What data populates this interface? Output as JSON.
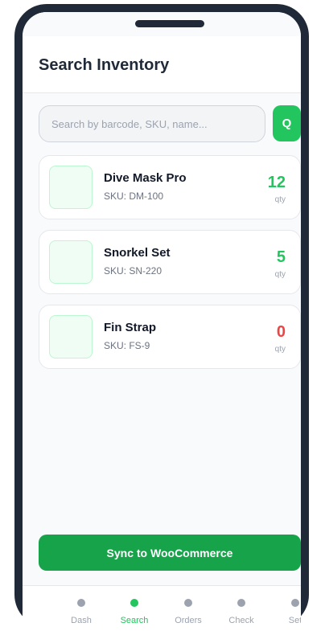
{
  "header": {
    "title": "Search Inventory"
  },
  "search": {
    "placeholder": "Search by barcode, SKU, name...",
    "value": "",
    "button_label": "Q"
  },
  "items": [
    {
      "name": "Dive Mask Pro",
      "sku": "SKU: DM-100",
      "qty": "12",
      "qty_label": "qty",
      "qty_color": "#22c55e"
    },
    {
      "name": "Snorkel Set",
      "sku": "SKU: SN-220",
      "qty": "5",
      "qty_label": "qty",
      "qty_color": "#22c55e"
    },
    {
      "name": "Fin Strap",
      "sku": "SKU: FS-9",
      "qty": "0",
      "qty_label": "qty",
      "qty_color": "#ef4444"
    }
  ],
  "sync": {
    "label": "Sync to WooCommerce"
  },
  "nav": {
    "active": "Search",
    "items": [
      {
        "label": "Dash",
        "icon": "dot-icon"
      },
      {
        "label": "Search",
        "icon": "dot-icon"
      },
      {
        "label": "Orders",
        "icon": "dot-icon"
      },
      {
        "label": "Check",
        "icon": "dot-icon"
      },
      {
        "label": "Set",
        "icon": "dot-icon"
      }
    ]
  },
  "colors": {
    "accent": "#22c55e",
    "accent_dark": "#16a34a",
    "danger": "#ef4444",
    "frame": "#1f2937"
  }
}
